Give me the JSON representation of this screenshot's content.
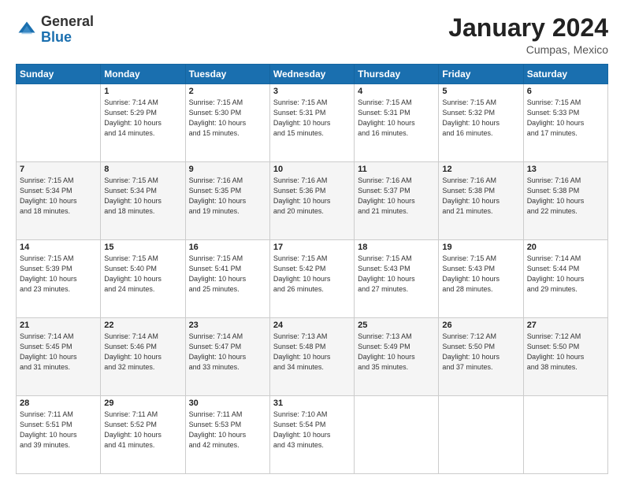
{
  "header": {
    "logo_general": "General",
    "logo_blue": "Blue",
    "month_title": "January 2024",
    "location": "Cumpas, Mexico"
  },
  "weekdays": [
    "Sunday",
    "Monday",
    "Tuesday",
    "Wednesday",
    "Thursday",
    "Friday",
    "Saturday"
  ],
  "weeks": [
    [
      {
        "day": "",
        "info": ""
      },
      {
        "day": "1",
        "info": "Sunrise: 7:14 AM\nSunset: 5:29 PM\nDaylight: 10 hours\nand 14 minutes."
      },
      {
        "day": "2",
        "info": "Sunrise: 7:15 AM\nSunset: 5:30 PM\nDaylight: 10 hours\nand 15 minutes."
      },
      {
        "day": "3",
        "info": "Sunrise: 7:15 AM\nSunset: 5:31 PM\nDaylight: 10 hours\nand 15 minutes."
      },
      {
        "day": "4",
        "info": "Sunrise: 7:15 AM\nSunset: 5:31 PM\nDaylight: 10 hours\nand 16 minutes."
      },
      {
        "day": "5",
        "info": "Sunrise: 7:15 AM\nSunset: 5:32 PM\nDaylight: 10 hours\nand 16 minutes."
      },
      {
        "day": "6",
        "info": "Sunrise: 7:15 AM\nSunset: 5:33 PM\nDaylight: 10 hours\nand 17 minutes."
      }
    ],
    [
      {
        "day": "7",
        "info": "Sunrise: 7:15 AM\nSunset: 5:34 PM\nDaylight: 10 hours\nand 18 minutes."
      },
      {
        "day": "8",
        "info": "Sunrise: 7:15 AM\nSunset: 5:34 PM\nDaylight: 10 hours\nand 18 minutes."
      },
      {
        "day": "9",
        "info": "Sunrise: 7:16 AM\nSunset: 5:35 PM\nDaylight: 10 hours\nand 19 minutes."
      },
      {
        "day": "10",
        "info": "Sunrise: 7:16 AM\nSunset: 5:36 PM\nDaylight: 10 hours\nand 20 minutes."
      },
      {
        "day": "11",
        "info": "Sunrise: 7:16 AM\nSunset: 5:37 PM\nDaylight: 10 hours\nand 21 minutes."
      },
      {
        "day": "12",
        "info": "Sunrise: 7:16 AM\nSunset: 5:38 PM\nDaylight: 10 hours\nand 21 minutes."
      },
      {
        "day": "13",
        "info": "Sunrise: 7:16 AM\nSunset: 5:38 PM\nDaylight: 10 hours\nand 22 minutes."
      }
    ],
    [
      {
        "day": "14",
        "info": "Sunrise: 7:15 AM\nSunset: 5:39 PM\nDaylight: 10 hours\nand 23 minutes."
      },
      {
        "day": "15",
        "info": "Sunrise: 7:15 AM\nSunset: 5:40 PM\nDaylight: 10 hours\nand 24 minutes."
      },
      {
        "day": "16",
        "info": "Sunrise: 7:15 AM\nSunset: 5:41 PM\nDaylight: 10 hours\nand 25 minutes."
      },
      {
        "day": "17",
        "info": "Sunrise: 7:15 AM\nSunset: 5:42 PM\nDaylight: 10 hours\nand 26 minutes."
      },
      {
        "day": "18",
        "info": "Sunrise: 7:15 AM\nSunset: 5:43 PM\nDaylight: 10 hours\nand 27 minutes."
      },
      {
        "day": "19",
        "info": "Sunrise: 7:15 AM\nSunset: 5:43 PM\nDaylight: 10 hours\nand 28 minutes."
      },
      {
        "day": "20",
        "info": "Sunrise: 7:14 AM\nSunset: 5:44 PM\nDaylight: 10 hours\nand 29 minutes."
      }
    ],
    [
      {
        "day": "21",
        "info": "Sunrise: 7:14 AM\nSunset: 5:45 PM\nDaylight: 10 hours\nand 31 minutes."
      },
      {
        "day": "22",
        "info": "Sunrise: 7:14 AM\nSunset: 5:46 PM\nDaylight: 10 hours\nand 32 minutes."
      },
      {
        "day": "23",
        "info": "Sunrise: 7:14 AM\nSunset: 5:47 PM\nDaylight: 10 hours\nand 33 minutes."
      },
      {
        "day": "24",
        "info": "Sunrise: 7:13 AM\nSunset: 5:48 PM\nDaylight: 10 hours\nand 34 minutes."
      },
      {
        "day": "25",
        "info": "Sunrise: 7:13 AM\nSunset: 5:49 PM\nDaylight: 10 hours\nand 35 minutes."
      },
      {
        "day": "26",
        "info": "Sunrise: 7:12 AM\nSunset: 5:50 PM\nDaylight: 10 hours\nand 37 minutes."
      },
      {
        "day": "27",
        "info": "Sunrise: 7:12 AM\nSunset: 5:50 PM\nDaylight: 10 hours\nand 38 minutes."
      }
    ],
    [
      {
        "day": "28",
        "info": "Sunrise: 7:11 AM\nSunset: 5:51 PM\nDaylight: 10 hours\nand 39 minutes."
      },
      {
        "day": "29",
        "info": "Sunrise: 7:11 AM\nSunset: 5:52 PM\nDaylight: 10 hours\nand 41 minutes."
      },
      {
        "day": "30",
        "info": "Sunrise: 7:11 AM\nSunset: 5:53 PM\nDaylight: 10 hours\nand 42 minutes."
      },
      {
        "day": "31",
        "info": "Sunrise: 7:10 AM\nSunset: 5:54 PM\nDaylight: 10 hours\nand 43 minutes."
      },
      {
        "day": "",
        "info": ""
      },
      {
        "day": "",
        "info": ""
      },
      {
        "day": "",
        "info": ""
      }
    ]
  ]
}
